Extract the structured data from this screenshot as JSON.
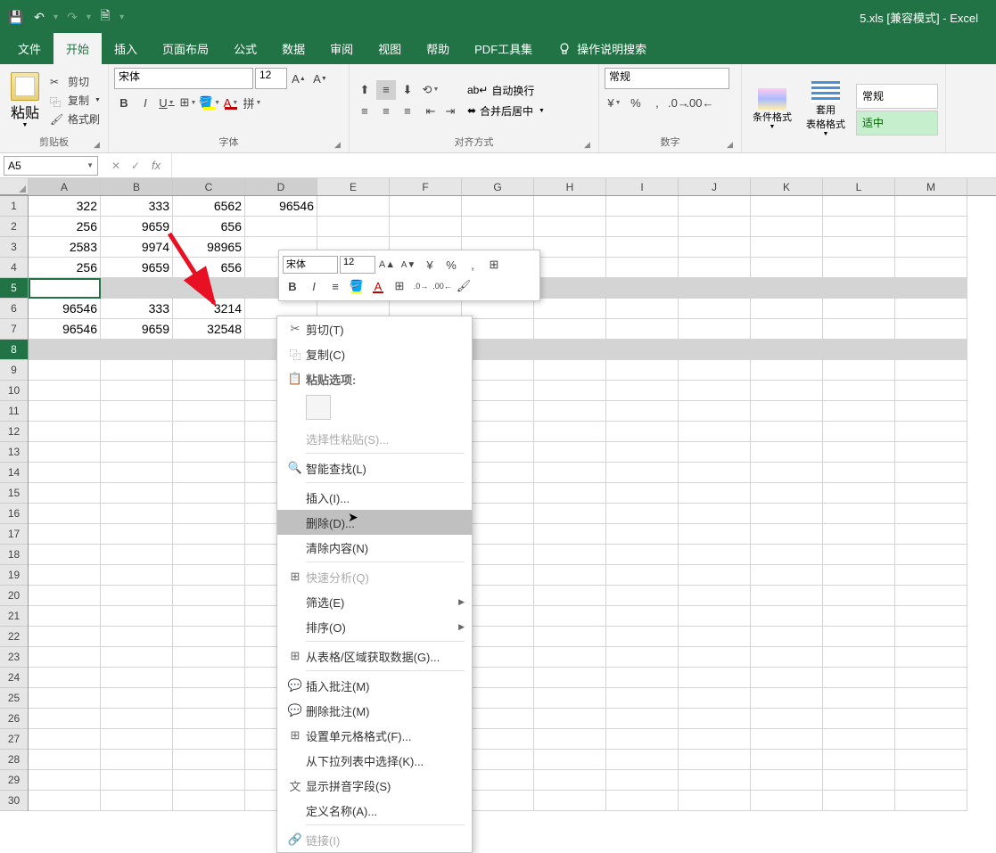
{
  "title": "5.xls  [兼容模式]  -  Excel",
  "tabs": [
    "文件",
    "开始",
    "插入",
    "页面布局",
    "公式",
    "数据",
    "审阅",
    "视图",
    "帮助",
    "PDF工具集"
  ],
  "search_hint": "操作说明搜索",
  "ribbon": {
    "paste_label": "粘贴",
    "cut": "剪切",
    "copy": "复制",
    "format_painter": "格式刷",
    "clipboard_group": "剪贴板",
    "font_name": "宋体",
    "font_size": "12",
    "font_group": "字体",
    "wrap_text": "自动换行",
    "merge_center": "合并后居中",
    "align_group": "对齐方式",
    "number_format": "常规",
    "number_group": "数字",
    "cond_format": "条件格式",
    "table_format": "套用\n表格格式",
    "style_normal": "常规",
    "style_ok": "适中"
  },
  "name_box": "A5",
  "columns": [
    "A",
    "B",
    "C",
    "D",
    "E",
    "F",
    "G",
    "H",
    "I",
    "J",
    "K",
    "L",
    "M"
  ],
  "row_numbers": [
    1,
    2,
    3,
    4,
    5,
    6,
    7,
    8,
    9,
    10,
    11,
    12,
    13,
    14,
    15,
    16,
    17,
    18,
    19,
    20,
    21,
    22,
    23,
    24,
    25,
    26,
    27,
    28,
    29,
    30
  ],
  "selected_rows": [
    5,
    8
  ],
  "active_cell_row": 5,
  "grid_data": {
    "1": [
      "322",
      "333",
      "6562",
      "96546"
    ],
    "2": [
      "256",
      "9659",
      "656",
      ""
    ],
    "3": [
      "2583",
      "9974",
      "98965",
      ""
    ],
    "4": [
      "256",
      "9659",
      "656",
      ""
    ],
    "5": [
      "",
      "",
      "",
      ""
    ],
    "6": [
      "96546",
      "333",
      "3214",
      ""
    ],
    "7": [
      "96546",
      "9659",
      "32548",
      ""
    ]
  },
  "mini_toolbar": {
    "font": "宋体",
    "size": "12"
  },
  "context_menu": {
    "cut": "剪切(T)",
    "copy": "复制(C)",
    "paste_options": "粘贴选项:",
    "paste_special": "选择性粘贴(S)...",
    "smart_lookup": "智能查找(L)",
    "insert": "插入(I)...",
    "delete": "删除(D)...",
    "clear": "清除内容(N)",
    "quick_analysis": "快速分析(Q)",
    "filter": "筛选(E)",
    "sort": "排序(O)",
    "get_data": "从表格/区域获取数据(G)...",
    "insert_comment": "插入批注(M)",
    "delete_comment": "删除批注(M)",
    "format_cells": "设置单元格格式(F)...",
    "dropdown": "从下拉列表中选择(K)...",
    "pinyin": "显示拼音字段(S)",
    "define_name": "定义名称(A)...",
    "link": "链接(I)"
  }
}
